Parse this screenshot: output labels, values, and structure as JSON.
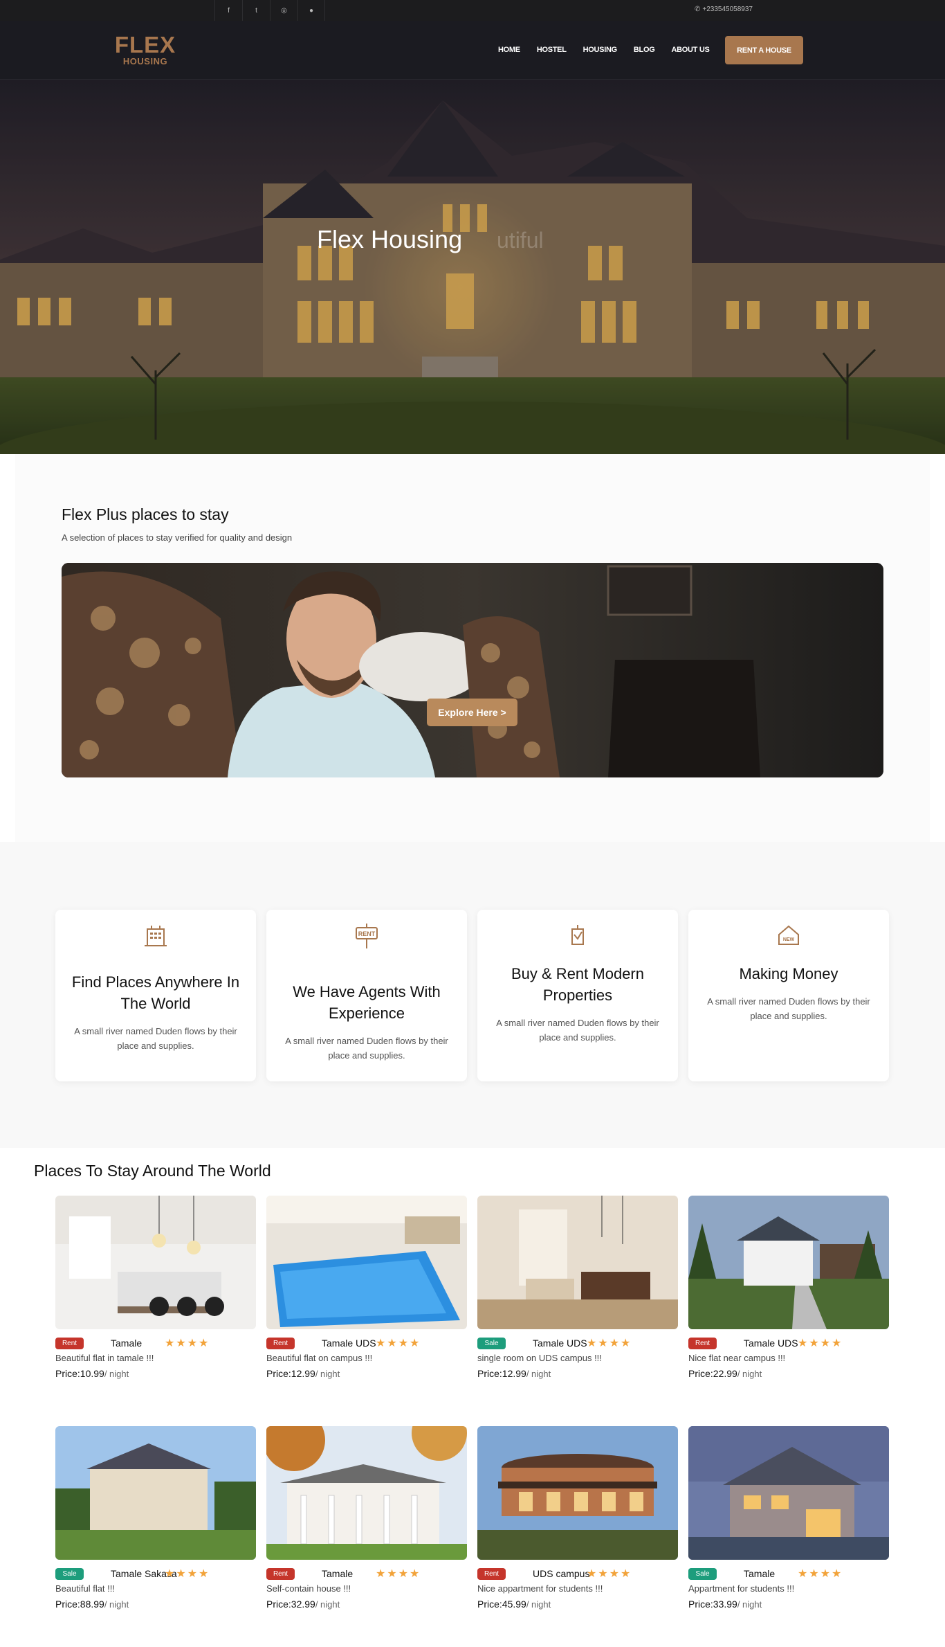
{
  "topbar": {
    "social": [
      {
        "icon": "facebook-icon",
        "glyph": "f"
      },
      {
        "icon": "twitter-icon",
        "glyph": "t"
      },
      {
        "icon": "instagram-icon",
        "glyph": "◎"
      },
      {
        "icon": "github-icon",
        "glyph": "●"
      }
    ],
    "phone_glyph": "✆",
    "phone": "+233545058937"
  },
  "brand": {
    "line1": "FLEX",
    "line2": "HOUSING",
    "color": "#a8774e"
  },
  "nav": {
    "items": [
      "HOME",
      "HOSTEL",
      "HOUSING",
      "BLOG",
      "ABOUT US"
    ],
    "cta": "RENT A HOUSE"
  },
  "hero": {
    "title": "Flex Housing",
    "ghost": "utiful"
  },
  "flexplus": {
    "title": "Flex Plus places to stay",
    "subtitle": "A selection of places to stay verified for quality and design",
    "button": "Explore Here >"
  },
  "features": [
    {
      "icon": "building-icon",
      "title": "Find Places Anywhere In The World",
      "desc": "A small river named Duden flows by their place and supplies."
    },
    {
      "icon": "rent-sign-icon",
      "title": "We Have Agents With Experience",
      "desc": "A small river named Duden flows by their place and supplies."
    },
    {
      "icon": "property-icon",
      "title": "Buy & Rent Modern Properties",
      "desc": "A small river named Duden flows by their place and supplies."
    },
    {
      "icon": "new-house-icon",
      "title": "Making Money",
      "desc": "A small river named Duden flows by their place and supplies."
    }
  ],
  "places": {
    "title": "Places To Stay Around The World",
    "star_glyphs": "★★★★",
    "per_night": "/ night",
    "items": [
      {
        "badge": "Rent",
        "location": "Tamale",
        "rating": 4,
        "desc": "Beautiful flat in tamale !!!",
        "price": "Price:10.99"
      },
      {
        "badge": "Rent",
        "location": "Tamale UDS",
        "rating": 4,
        "desc": "Beautiful flat on campus !!!",
        "price": "Price:12.99"
      },
      {
        "badge": "Sale",
        "location": "Tamale UDS",
        "rating": 4,
        "desc": "single room on UDS campus !!!",
        "price": "Price:12.99"
      },
      {
        "badge": "Rent",
        "location": "Tamale UDS",
        "rating": 4,
        "desc": "Nice flat near campus !!!",
        "price": "Price:22.99"
      },
      {
        "badge": "Sale",
        "location": "Tamale Sakasa",
        "rating": 4,
        "desc": "Beautiful flat !!!",
        "price": "Price:88.99"
      },
      {
        "badge": "Rent",
        "location": "Tamale",
        "rating": 4,
        "desc": "Self-contain house !!!",
        "price": "Price:32.99"
      },
      {
        "badge": "Rent",
        "location": "UDS campus",
        "rating": 4,
        "desc": "Nice appartment for students !!!",
        "price": "Price:45.99"
      },
      {
        "badge": "Sale",
        "location": "Tamale",
        "rating": 4,
        "desc": "Appartment for students !!!",
        "price": "Price:33.99"
      }
    ]
  },
  "colors": {
    "accent": "#a8774e",
    "rent": "#c5352b",
    "sale": "#1d9d7c",
    "star": "#f2a33a"
  }
}
